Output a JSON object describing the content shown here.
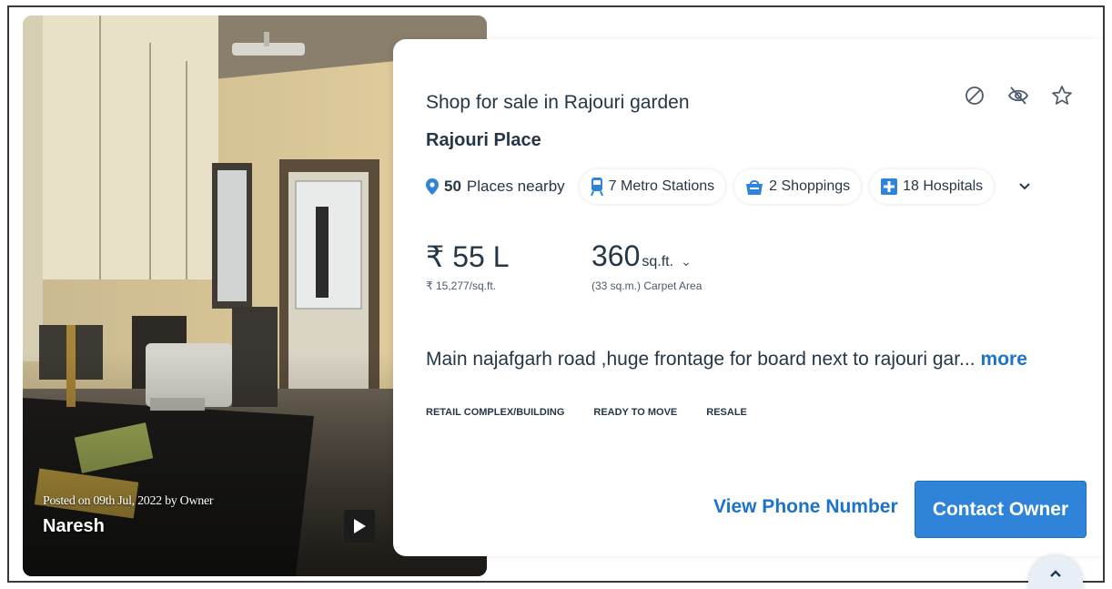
{
  "photo": {
    "posted_text": "Posted on 09th Jul, 2022 by Owner",
    "owner_name": "Naresh"
  },
  "listing": {
    "title": "Shop for sale in Rajouri garden",
    "project": "Rajouri Place",
    "nearby": {
      "count": "50",
      "label": "Places nearby",
      "chips": [
        {
          "icon": "metro-icon",
          "label": "7 Metro Stations"
        },
        {
          "icon": "shopping-bag-icon",
          "label": "2 Shoppings"
        },
        {
          "icon": "hospital-icon",
          "label": "18 Hospitals"
        }
      ]
    },
    "price": "₹ 55 L",
    "price_per_sqft": "₹ 15,277/sq.ft.",
    "area_value": "360",
    "area_unit": "sq.ft.",
    "area_sub": "(33 sq.m.) Carpet Area",
    "description": "Main najafgarh road ,huge frontage for board next to rajouri gar...",
    "more_label": "more",
    "tags": [
      "RETAIL COMPLEX/BUILDING",
      "READY TO MOVE",
      "RESALE"
    ]
  },
  "actions": {
    "view_phone_label": "View Phone Number",
    "contact_label": "Contact Owner"
  },
  "colors": {
    "accent": "#2f83d8",
    "link": "#1d72c9",
    "text": "#253746"
  }
}
